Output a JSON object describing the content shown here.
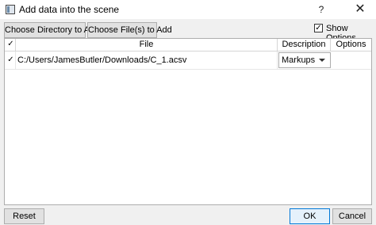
{
  "window": {
    "title": "Add data into the scene",
    "help_symbol": "?",
    "close_symbol": "✕",
    "app_icon": "slicer-window-icon"
  },
  "toolbar": {
    "choose_directory_label": "Choose Directory to Add",
    "choose_files_label": "Choose File(s) to Add",
    "show_options_label": "Show Options",
    "show_options_checked": true
  },
  "table": {
    "select_all_checked": true,
    "columns": [
      "File",
      "Description",
      "Options"
    ],
    "rows": [
      {
        "checked": true,
        "file": "C:/Users/JamesButler/Downloads/C_1.acsv",
        "description": "Markups",
        "options": ""
      }
    ]
  },
  "footer": {
    "reset_label": "Reset",
    "ok_label": "OK",
    "cancel_label": "Cancel"
  }
}
